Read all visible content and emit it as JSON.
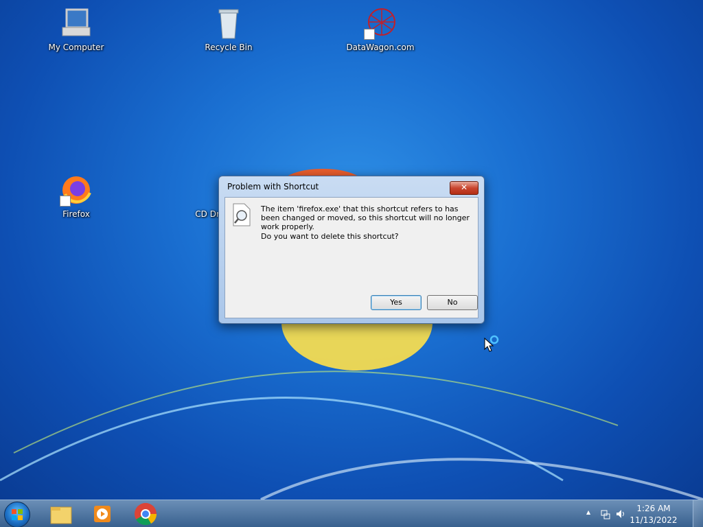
{
  "desktop": {
    "icons": [
      {
        "label": "My Computer"
      },
      {
        "label": "Recycle Bin"
      },
      {
        "label": "DataWagon.com"
      },
      {
        "label": "Firefox"
      },
      {
        "label": "CD Drive"
      }
    ]
  },
  "dialog": {
    "title": "Problem with Shortcut",
    "close_label": "✕",
    "message": "The item 'firefox.exe' that this shortcut refers to has been changed or moved, so this shortcut will no longer work properly.",
    "question": "Do you want to delete this shortcut?",
    "yes_label": "Yes",
    "no_label": "No"
  },
  "taskbar": {
    "time": "1:26 AM",
    "date": "11/13/2022",
    "tray_expand": "▲"
  }
}
